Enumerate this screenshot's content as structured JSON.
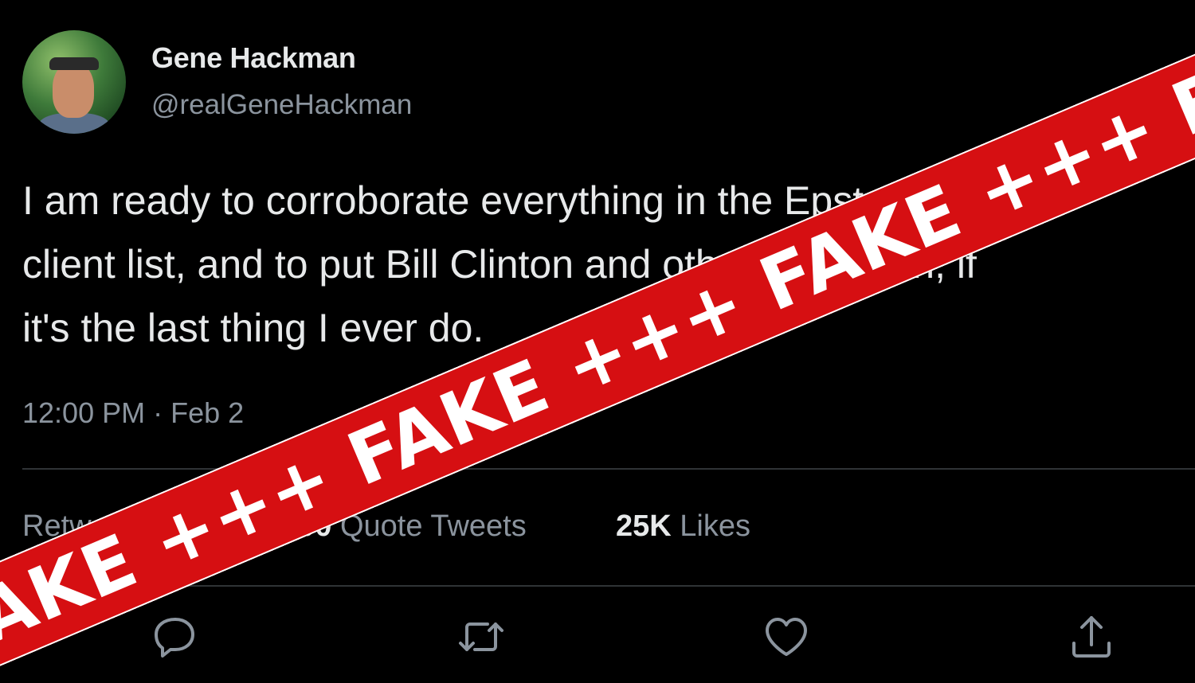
{
  "user": {
    "display_name": "Gene Hackman",
    "handle": "@realGeneHackman"
  },
  "tweet": {
    "lines": [
      "I am ready to corroborate everything in the Epstein",
      "client list, and to put Bill Clinton and others in prison, if",
      "it's the last thing I ever do."
    ],
    "timestamp": "12:00 PM · Feb 2"
  },
  "stats": {
    "retweets_label": "Retweets",
    "quotes_count": "200",
    "quotes_label": "Quote Tweets",
    "likes_count": "25K",
    "likes_label": "Likes"
  },
  "actions": [
    "reply-icon",
    "retweet-icon",
    "like-icon",
    "share-icon"
  ],
  "overlay": {
    "text": "FAKE +++ FAKE +++ FAKE +++ FAKE +++ FAKE +++",
    "color": "#d60f12"
  }
}
